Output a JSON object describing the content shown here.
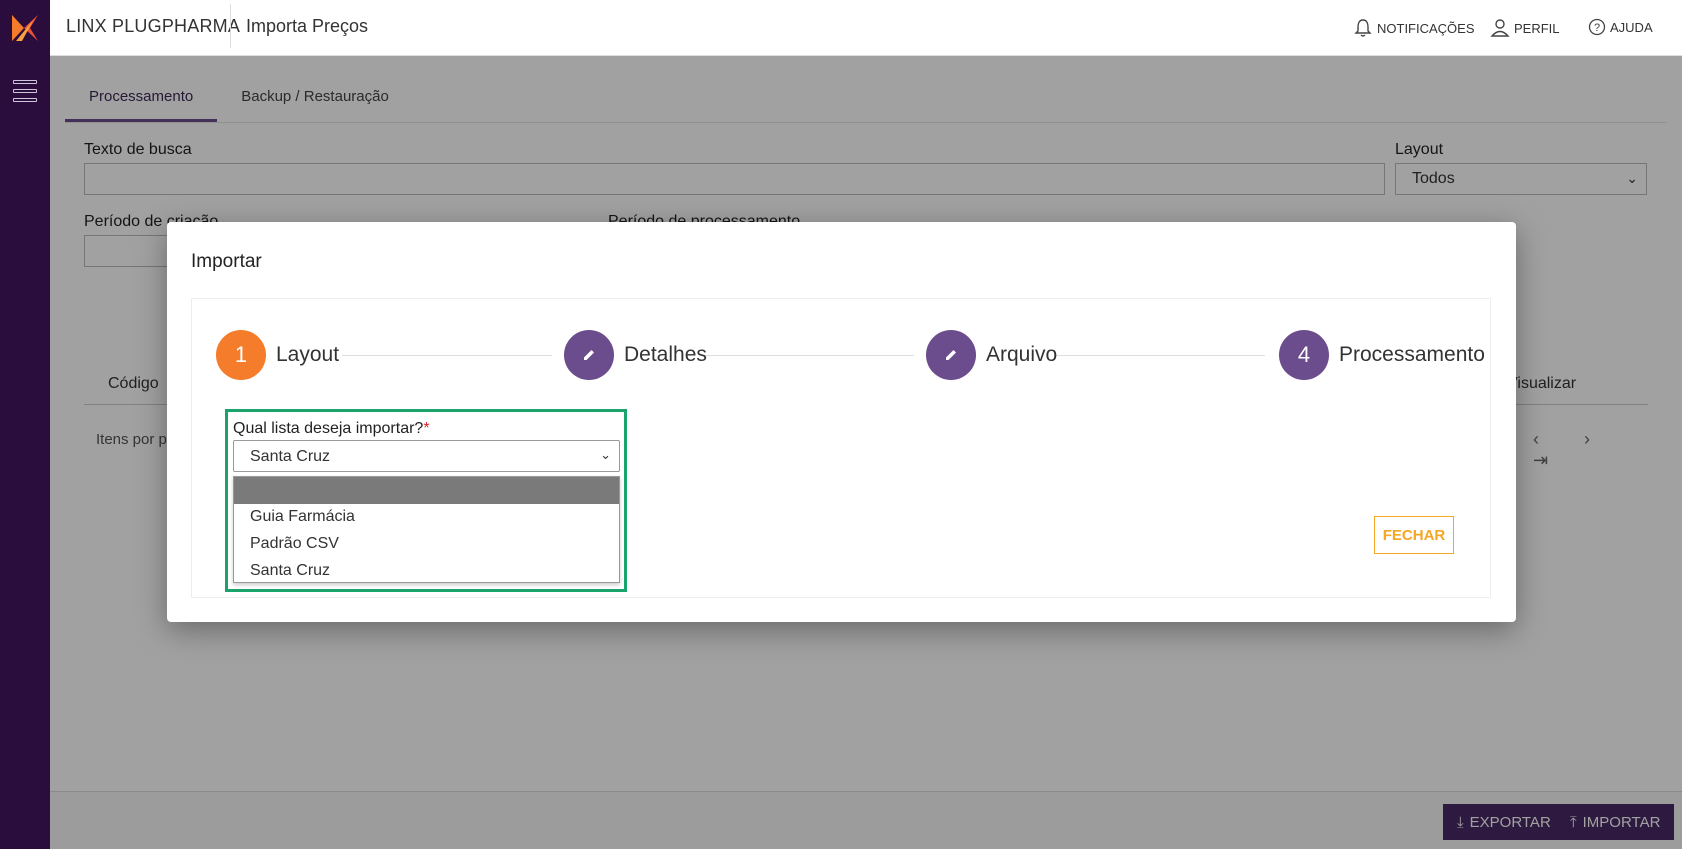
{
  "header": {
    "app_name": "LINX PLUGPHARMA",
    "page_title": "Importa Preços",
    "notifications": "NOTIFICAÇÕES",
    "profile": "PERFIL",
    "help": "AJUDA"
  },
  "tabs": [
    {
      "label": "Processamento",
      "active": true
    },
    {
      "label": "Backup / Restauração",
      "active": false
    }
  ],
  "filters": {
    "search_label": "Texto de busca",
    "search_value": "",
    "layout_label": "Layout",
    "layout_value": "Todos",
    "creation_period_label": "Período de criação",
    "processing_period_label": "Período de processamento"
  },
  "table": {
    "col_code": "Código",
    "col_view": "Visualizar",
    "items_per_page_label": "Itens por página"
  },
  "footer": {
    "export_label": "EXPORTAR",
    "import_label": "IMPORTAR"
  },
  "modal": {
    "title": "Importar",
    "steps": [
      {
        "number": "1",
        "label": "Layout",
        "state": "active"
      },
      {
        "number": "",
        "label": "Detalhes",
        "state": "done"
      },
      {
        "number": "",
        "label": "Arquivo",
        "state": "done"
      },
      {
        "number": "4",
        "label": "Processamento",
        "state": "pending"
      }
    ],
    "question_label": "Qual lista deseja importar?",
    "required_mark": "*",
    "selected_value": "Santa Cruz",
    "options": [
      "",
      "Guia Farmácia",
      "Padrão CSV",
      "Santa Cruz"
    ],
    "close_label": "FECHAR"
  },
  "colors": {
    "sidebar": "#2b0d3d",
    "accent_purple": "#6b4c8c",
    "accent_orange": "#f47c2a",
    "close_orange": "#f5a623",
    "highlight_green": "#1aa36a"
  }
}
